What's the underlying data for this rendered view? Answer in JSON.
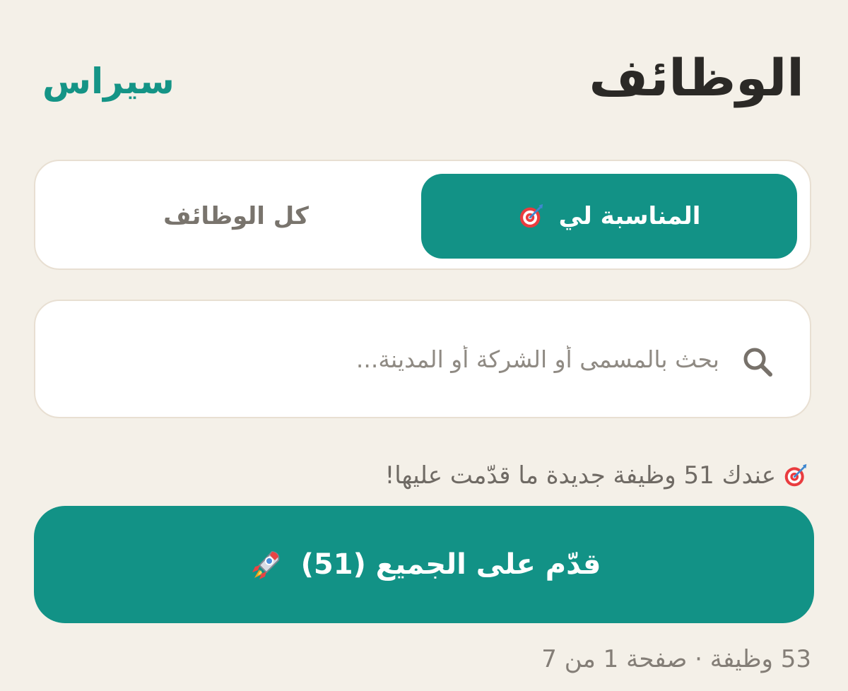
{
  "header": {
    "title": "الوظائف",
    "brand": "سيراس"
  },
  "tabs": [
    {
      "label": "المناسبة لي",
      "icon": "target-icon",
      "state": "selected"
    },
    {
      "label": "كل الوظائف",
      "state": "unselected"
    }
  ],
  "search": {
    "value": "",
    "placeholder": "بحث بالمسمى أو الشركة أو المدينة...",
    "icon": "search-icon"
  },
  "notice": {
    "icon": "target-icon",
    "text": "عندك 51 وظيفة جديدة ما قدّمت عليها!"
  },
  "apply_all": {
    "label": "قدّم على الجميع (51)",
    "icon": "rocket-icon"
  },
  "pagination": {
    "summary": "53 وظيفة · صفحة 1 من 7"
  },
  "colors": {
    "background": "#f4f0e8",
    "accent": "#129286",
    "surface": "#ffffff",
    "text": "#2b2926",
    "muted_text": "#79746d"
  }
}
